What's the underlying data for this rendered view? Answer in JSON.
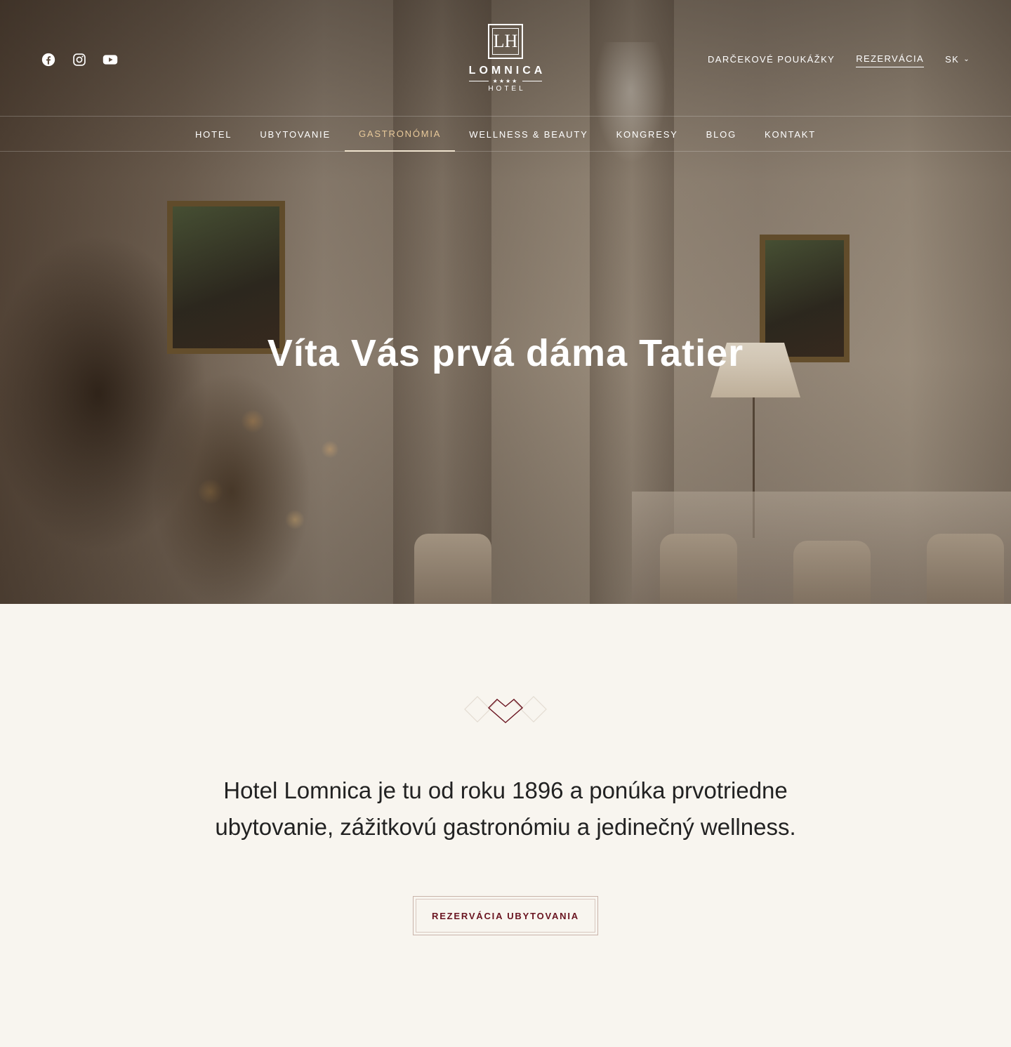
{
  "header": {
    "socials": [
      {
        "icon": "facebook-icon"
      },
      {
        "icon": "instagram-icon"
      },
      {
        "icon": "youtube-icon"
      }
    ],
    "logo": {
      "monogram": "LH",
      "name": "LOMNICA",
      "stars": "★★★★",
      "sub": "HOTEL"
    },
    "top_links": {
      "gift_vouchers": "DARČEKOVÉ POUKÁŽKY",
      "reservation": "REZERVÁCIA",
      "language": "SK"
    },
    "nav": [
      {
        "label": "HOTEL"
      },
      {
        "label": "UBYTOVANIE"
      },
      {
        "label": "GASTRONÓMIA",
        "active": true
      },
      {
        "label": "WELLNESS & BEAUTY"
      },
      {
        "label": "KONGRESY"
      },
      {
        "label": "BLOG"
      },
      {
        "label": "KONTAKT"
      }
    ]
  },
  "hero": {
    "title": "Víta Vás prvá dáma Tatier"
  },
  "intro": {
    "text": "Hotel Lomnica je tu od roku 1896 a ponúka prvotriedne ubytovanie, zážitkovú gastronómiu a jedinečný wellness.",
    "cta_label": "REZERVÁCIA UBYTOVANIA"
  },
  "colors": {
    "accent_gold": "#e8c99a",
    "cta_text": "#6a1420",
    "page_background": "#f8f5ef"
  }
}
